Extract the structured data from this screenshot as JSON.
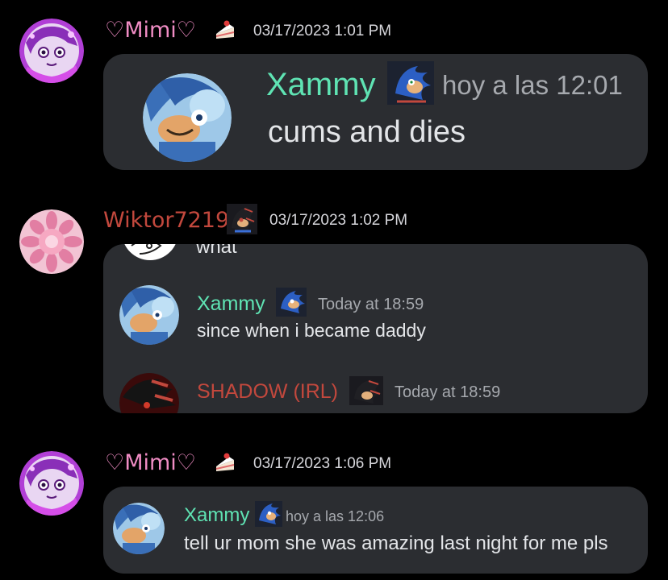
{
  "messages": [
    {
      "author": "♡Mimi♡",
      "author_color": "#f08cc4",
      "badge_icon": "cake-slice-icon",
      "timestamp": "03/17/2023 1:01 PM",
      "attachment": {
        "quoted_author": "Xammy",
        "quoted_time": "hoy a las 12:01",
        "quoted_text": "cums and dies"
      }
    },
    {
      "author": "Wiktor7219",
      "author_color": "#c2483d",
      "badge_icon": "shadow-hedgehog-icon",
      "timestamp": "03/17/2023 1:02 PM",
      "attachment": {
        "top_partial_text": "what",
        "quoted_author": "Xammy",
        "quoted_time": "Today at 18:59",
        "quoted_text": "since when i became daddy",
        "third_author": "SHADOW (IRL)",
        "third_author_color": "#c2483d",
        "third_time": "Today at 18:59"
      }
    },
    {
      "author": "♡Mimi♡",
      "author_color": "#f08cc4",
      "badge_icon": "cake-slice-icon",
      "timestamp": "03/17/2023 1:06 PM",
      "attachment": {
        "quoted_author": "Xammy",
        "quoted_time": "hoy a las 12:06",
        "quoted_text": "tell ur mom she was amazing last night for me pls"
      }
    }
  ],
  "colors": {
    "background": "#000000",
    "embed_background": "#2b2d31",
    "quoted_name": "#5fe3b3",
    "muted_text": "#a6a9ae",
    "message_text": "#e3e5e8"
  }
}
